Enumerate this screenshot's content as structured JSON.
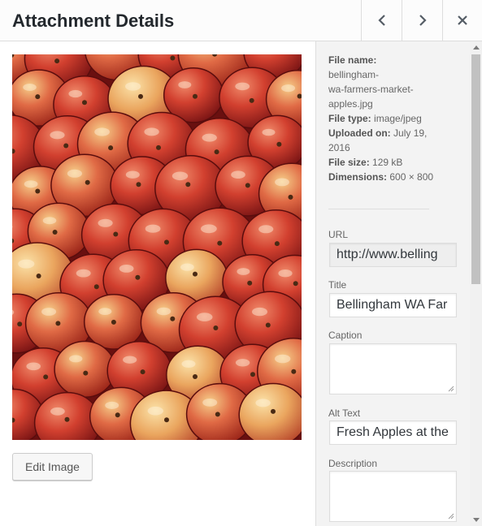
{
  "header": {
    "title": "Attachment Details",
    "prev_icon": "chevron-left-icon",
    "next_icon": "chevron-right-icon",
    "close_icon": "close-icon"
  },
  "media": {
    "image_alt": "Fresh Apples at the",
    "edit_button_label": "Edit Image"
  },
  "details": {
    "file_name_label": "File name:",
    "file_name_value": "bellingham-wa-farmers-market-apples.jpg",
    "file_type_label": "File type:",
    "file_type_value": "image/jpeg",
    "uploaded_label": "Uploaded on:",
    "uploaded_value": "July 19, 2016",
    "file_size_label": "File size:",
    "file_size_value": "129 kB",
    "dimensions_label": "Dimensions:",
    "dimensions_value": "600 × 800"
  },
  "fields": {
    "url_label": "URL",
    "url_value": "http://www.belling",
    "title_label": "Title",
    "title_value": "Bellingham WA Far",
    "caption_label": "Caption",
    "caption_value": "",
    "alt_label": "Alt Text",
    "alt_value": "Fresh Apples at the",
    "description_label": "Description",
    "description_value": ""
  },
  "colors": {
    "header_bg": "#fcfcfc",
    "sidebar_bg": "#f3f3f3",
    "apple_red": "#c0302a",
    "apple_yellow": "#e9b45a"
  }
}
